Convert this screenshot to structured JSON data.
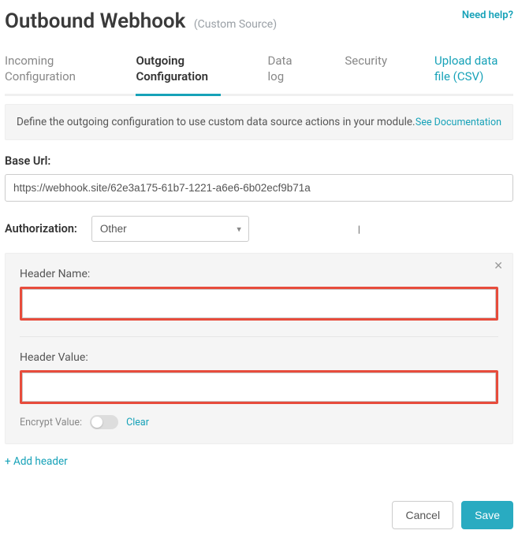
{
  "header": {
    "title": "Outbound Webhook",
    "subtitle": "(Custom Source)",
    "help_link": "Need help?"
  },
  "tabs": {
    "incoming": "Incoming Configuration",
    "outgoing": "Outgoing Configuration",
    "datalog": "Data log",
    "security": "Security",
    "upload": "Upload data file (CSV)"
  },
  "info": {
    "text": "Define the outgoing configuration to use custom data source actions in your module.",
    "doc_link": "See Documentation"
  },
  "base_url": {
    "label": "Base Url:",
    "value": "https://webhook.site/62e3a175-61b7-1221-a6e6-6b02ecf9b71a"
  },
  "authorization": {
    "label": "Authorization:",
    "selected": "Other"
  },
  "header_form": {
    "name_label": "Header Name:",
    "name_value": "",
    "value_label": "Header Value:",
    "value_value": "",
    "encrypt_label": "Encrypt Value:",
    "clear": "Clear"
  },
  "add_header": "+ Add header",
  "footer": {
    "cancel": "Cancel",
    "save": "Save"
  }
}
